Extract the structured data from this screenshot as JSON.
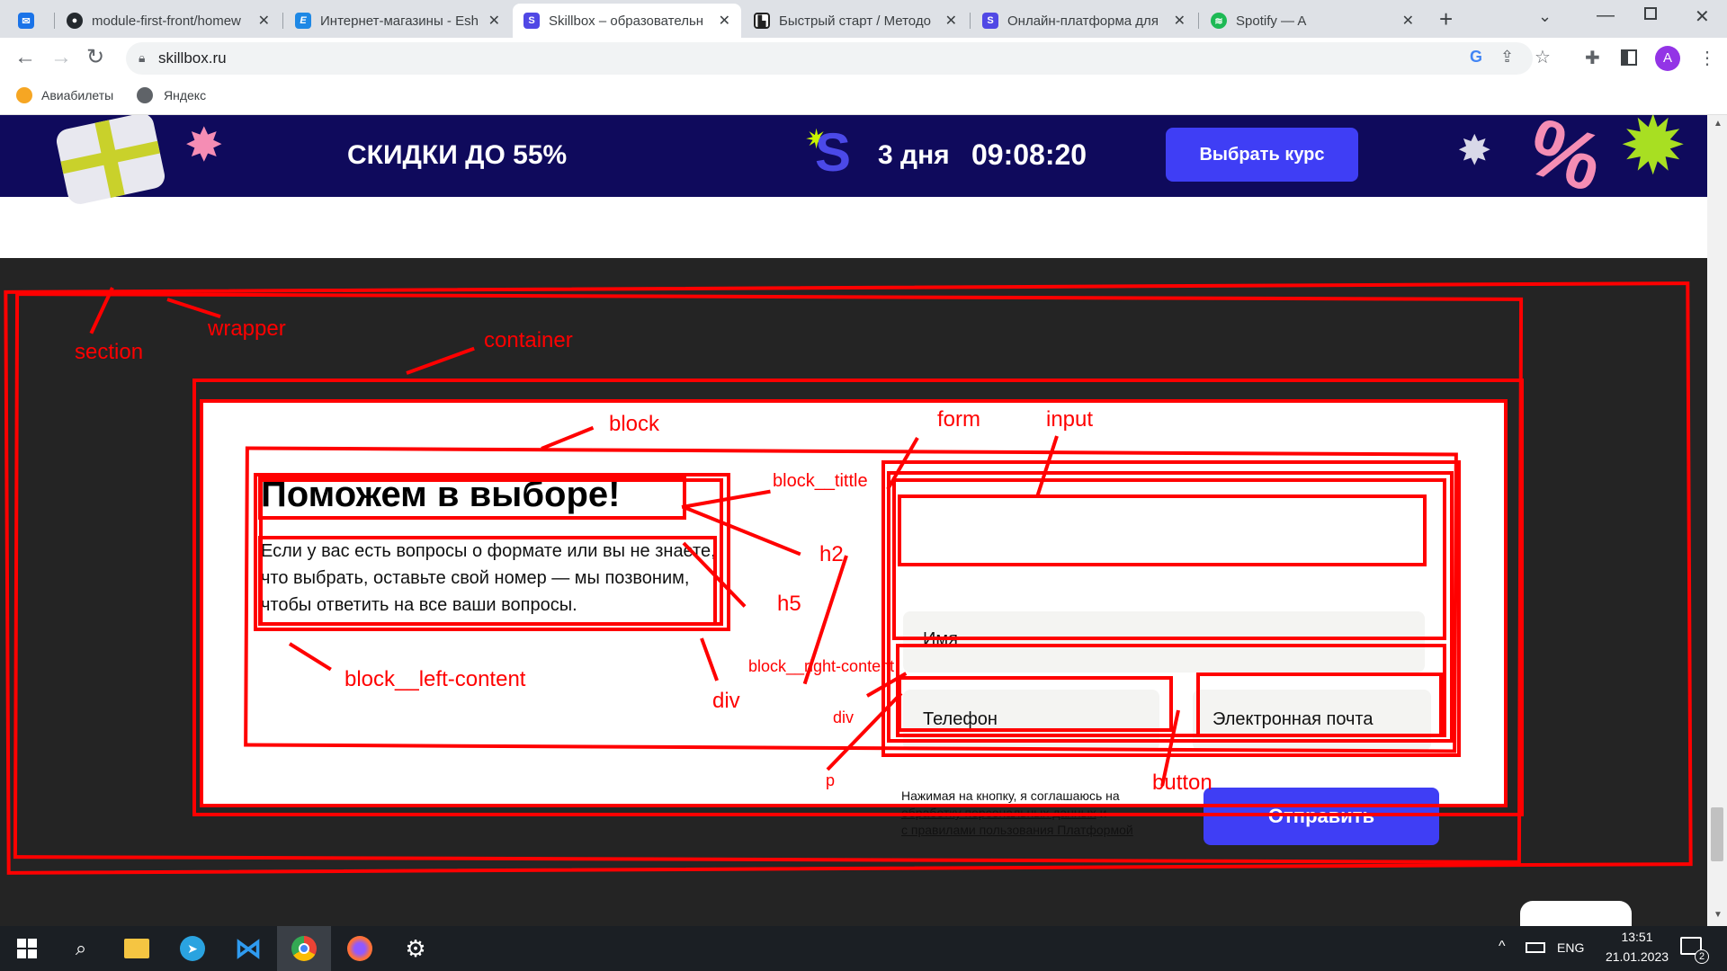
{
  "browser": {
    "tabs": [
      {
        "label": "",
        "favicon": "mail-icon",
        "color": "#1a73e8"
      },
      {
        "label": "module-first-front/homew",
        "favicon": "github-icon",
        "color": "#24292e"
      },
      {
        "label": "Интернет-магазины - Esh",
        "favicon": "e-icon",
        "color": "#1e88e5"
      },
      {
        "label": "Skillbox – образовательн",
        "favicon": "s-icon",
        "color": "#5048e5"
      },
      {
        "label": "Быстрый старт / Методо",
        "favicon": "chart-icon",
        "color": "#222222"
      },
      {
        "label": "Онлайн-платформа для",
        "favicon": "s-icon",
        "color": "#5048e5"
      },
      {
        "label": "Spotify — A",
        "favicon": "spotify-icon",
        "color": "#1db954"
      }
    ],
    "url": "skillbox.ru",
    "profile_letter": "A",
    "bookmarks": [
      "Авиабилеты",
      "Яндекс"
    ]
  },
  "promo": {
    "headline": "СКИДКИ ДО 55%",
    "days": "3 дня",
    "timer": "09:08:20",
    "cta": "Выбрать курс"
  },
  "block": {
    "title": "Поможем в выборе!",
    "text": "Если у вас есть вопросы о формате или вы не знаете, что выбрать, оставьте свой номер — мы позвоним, чтобы ответить на все ваши вопросы.",
    "name_placeholder": "Имя",
    "phone_placeholder": "Телефон",
    "email_placeholder": "Электронная почта",
    "consent_prefix": "Нажимая на кнопку, я соглашаюсь на",
    "consent_link1": "обработку персональных данных",
    "consent_mid": " и",
    "consent_link2": "с правилами пользования Платформой",
    "submit": "Отправить"
  },
  "annotations": {
    "section": "section",
    "wrapper": "wrapper",
    "container": "container",
    "block": "block",
    "form": "form",
    "input": "input",
    "block_title": "block__tittle",
    "h2": "h2",
    "h5": "h5",
    "left_content": "block__left-content",
    "div1": "div",
    "right_content": "block__right-content",
    "div2": "div",
    "p": "p",
    "button": "button"
  },
  "taskbar": {
    "lang": "ENG",
    "time": "13:51",
    "date": "21.01.2023",
    "notif_count": "2"
  }
}
